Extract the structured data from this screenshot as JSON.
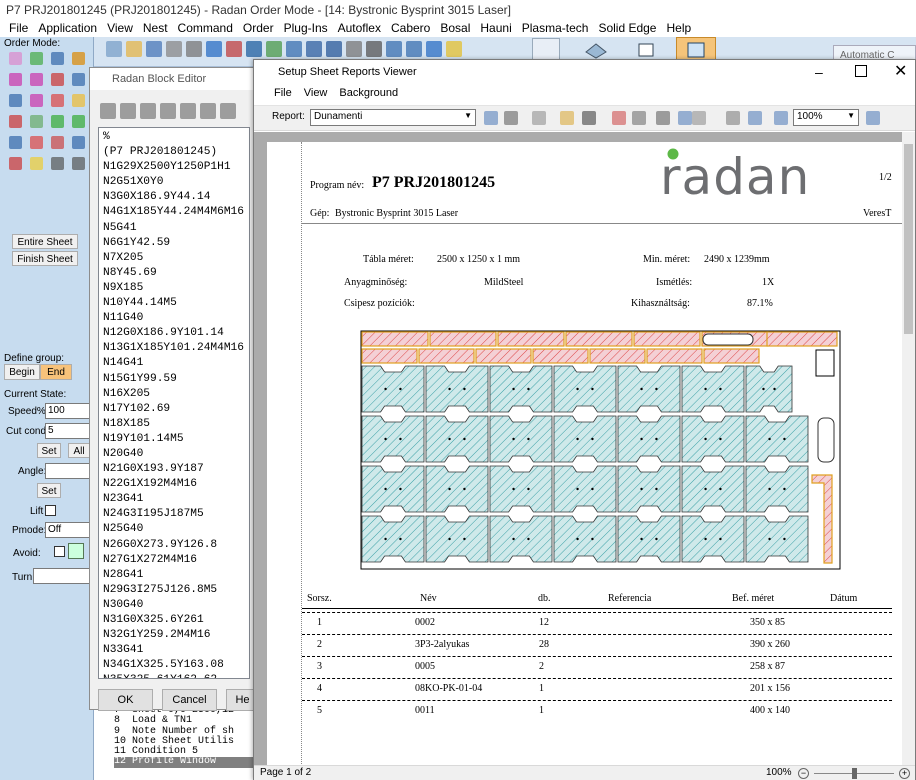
{
  "main": {
    "title": "P7 PRJ201801245 (PRJ201801245) - Radan Order Mode - [14: Bystronic Bysprint 3015 Laser]",
    "menu": [
      "File",
      "Application",
      "View",
      "Nest",
      "Command",
      "Order",
      "Plug-Ins",
      "Autoflex",
      "Cabero",
      "Bosal",
      "Hauni",
      "Plasma-tech",
      "Solid Edge",
      "Help"
    ],
    "toolbar_right": "Automatic C"
  },
  "side": {
    "order_mode": "Order Mode:",
    "entire_sheet": "Entire Sheet",
    "finish_sheet": "Finish Sheet",
    "define_group": "Define group:",
    "begin": "Begin",
    "end": "End",
    "current_state": "Current State:",
    "speed_lbl": "Speed%",
    "speed_val": "100",
    "cut_lbl": "Cut cond",
    "cut_val": "5",
    "set": "Set",
    "all": "All",
    "angle": "Angle:",
    "set2": "Set",
    "lift": "Lift",
    "pmode_lbl": "Pmode:",
    "pmode_val": "Off",
    "avoid": "Avoid:",
    "turn": "Turn"
  },
  "block_editor": {
    "title": "Radan Block Editor",
    "ok": "OK",
    "cancel": "Cancel",
    "help": "He",
    "lines": [
      "%",
      "(P7 PRJ201801245)",
      "N1G29X2500Y1250P1H1",
      "N2G51X0Y0",
      "N3G0X186.9Y44.14",
      "N4G1X185Y44.24M4M6M16",
      "N5G41",
      "N6G1Y42.59",
      "N7X205",
      "N8Y45.69",
      "N9X185",
      "N10Y44.14M5",
      "N11G40",
      "N12G0X186.9Y101.14",
      "N13G1X185Y101.24M4M16",
      "N14G41",
      "N15G1Y99.59",
      "N16X205",
      "N17Y102.69",
      "N18X185",
      "N19Y101.14M5",
      "N20G40",
      "N21G0X193.9Y187",
      "N22G1X192M4M16",
      "N23G41",
      "N24G3I195J187M5",
      "N25G40",
      "N26G0X273.9Y126.8",
      "N27G1X272M4M16",
      "N28G41",
      "N29G3I275J126.8M5",
      "N30G40",
      "N31G0X325.6Y261",
      "N32G1Y259.2M4M16",
      "N33G41",
      "N34G1X325.5Y163.08",
      "N35X325.61Y162.62"
    ]
  },
  "cad_list": [
    "7  Sheet 0,0 2500,12",
    "8  Load & TN1",
    "9  Note Number of sh",
    "10 Note Sheet Utilis",
    "11 Condition 5",
    "12 Profile Window"
  ],
  "viewer": {
    "title": "Setup Sheet Reports Viewer",
    "menu": [
      "File",
      "View",
      "Background"
    ],
    "report_lbl": "Report:",
    "report_val": "Dunamenti",
    "zoom_val": "100%",
    "status_left": "Page 1 of 2",
    "status_zoom": "100%"
  },
  "report": {
    "program_lbl": "Program név:",
    "program_val": "P7 PRJ201801245",
    "page_no": "1/2",
    "logo": "radan",
    "gep_lbl": "Gép:",
    "gep_val": "Bystronic Bysprint 3015 Laser",
    "user": "VeresT",
    "tabla_lbl": "Tábla méret:",
    "tabla_val": "2500 x 1250 x 1 mm",
    "min_lbl": "Min. méret:",
    "min_val": "2490 x 1239mm",
    "anyag_lbl": "Anyagminőség:",
    "anyag_val": "MildSteel",
    "ism_lbl": "Ismétlés:",
    "ism_val": "1X",
    "csipesz_lbl": "Csipesz pozíciók:",
    "kih_lbl": "Kihasználtság:",
    "kih_val": "87.1%",
    "cols": [
      "Sorsz.",
      "Név",
      "db.",
      "Referencia",
      "Bef. méret",
      "Dátum"
    ],
    "rows": [
      [
        "1",
        "0002",
        "12",
        "350 x 85"
      ],
      [
        "2",
        "3P3-2alyukas",
        "28",
        "390 x 260"
      ],
      [
        "3",
        "0005",
        "2",
        "258 x 87"
      ],
      [
        "4",
        "08KO-PK-01-04",
        "1",
        "201 x 156"
      ],
      [
        "5",
        "0011",
        "1",
        "400 x 140"
      ]
    ]
  },
  "colors": {
    "accent": "#2a5a8c",
    "toolbar": "#d6e4f2",
    "logo_green": "#5db847",
    "logo_gray": "#6d6e71",
    "part_fill": "#cfe9ea",
    "strip_fill": "#f4d0d5",
    "strip_edge": "#e0a020"
  }
}
